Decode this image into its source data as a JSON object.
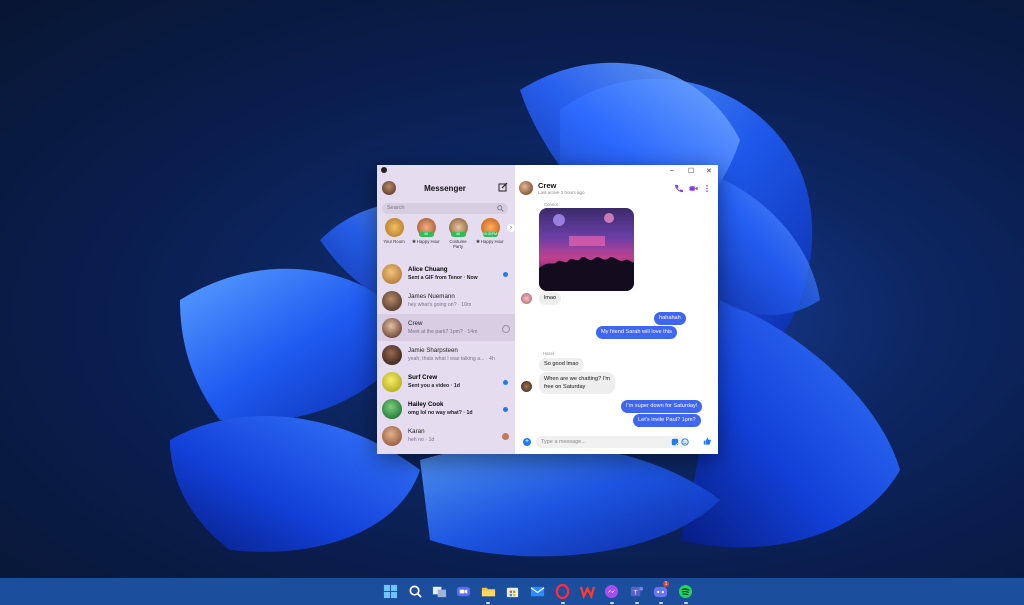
{
  "sidebar": {
    "title": "Messenger",
    "search_placeholder": "Search",
    "stories": [
      {
        "label": "Your Room",
        "badge": "",
        "color": "#e1a743"
      },
      {
        "label": "✱ Happy Hour",
        "badge": "46",
        "color": "#d88a5a"
      },
      {
        "label": "Costume Party",
        "badge": "46",
        "color": "#c9a06a"
      },
      {
        "label": "✱ Happy Hour",
        "badge": "10:30PM",
        "color": "#e28b3c"
      }
    ],
    "chats": [
      {
        "name": "Alice Chuang",
        "preview": "Sent a GIF from Tenor · Now",
        "unread": true,
        "color": "#c89a55"
      },
      {
        "name": "James Nuemann",
        "preview": "hey what's going on? · 10m",
        "unread": false,
        "color": "#7a5a48"
      },
      {
        "name": "Crew",
        "preview": "Meet at the park? 1pm? · 14m",
        "unread": false,
        "color": "#6f4a3a"
      },
      {
        "name": "Jamie Sharpsteen",
        "preview": "yeah, thats what I was talking a... · 4h",
        "unread": false,
        "color": "#5a3a2e"
      },
      {
        "name": "Surf Crew",
        "preview": "Sent you a video · 1d",
        "unread": true,
        "color": "#d9d23a"
      },
      {
        "name": "Hailey Cook",
        "preview": "omg lol no way what? · 1d",
        "unread": true,
        "color": "#3a8a4a"
      },
      {
        "name": "Karan",
        "preview": "heh no · 1d",
        "unread": false,
        "color": "#c48a6a"
      }
    ]
  },
  "chat": {
    "name": "Crew",
    "status": "Last active 2 hours ago",
    "window_controls": [
      "–",
      "☐",
      "✕"
    ],
    "messages": {
      "photo_sender": "Connor",
      "lmao": "lmao",
      "out1": "hahahah",
      "out2": "My friend Sarah will love this",
      "hazel_sender": "Hazel",
      "in1": "So good lmao",
      "in2a": "When are we chatting? I'm",
      "in2b": "free on Saturday",
      "out3": "I'm super down for Saturday!",
      "out4": "Let's invite Paul? 1pm?"
    },
    "composer_placeholder": "Type a message..."
  },
  "taskbar": {
    "icons": [
      "windows-start",
      "search",
      "task-view",
      "video-call",
      "file-explorer",
      "store",
      "mail",
      "opera",
      "office",
      "messenger",
      "teams",
      "discord",
      "spotify"
    ],
    "discord_badge": "1"
  },
  "colors": {
    "accent": "#3f66ee",
    "sidebar_bg": "#e6dcef",
    "taskbar": "#1b4f9e",
    "call_icons": "#8a3ce0"
  }
}
